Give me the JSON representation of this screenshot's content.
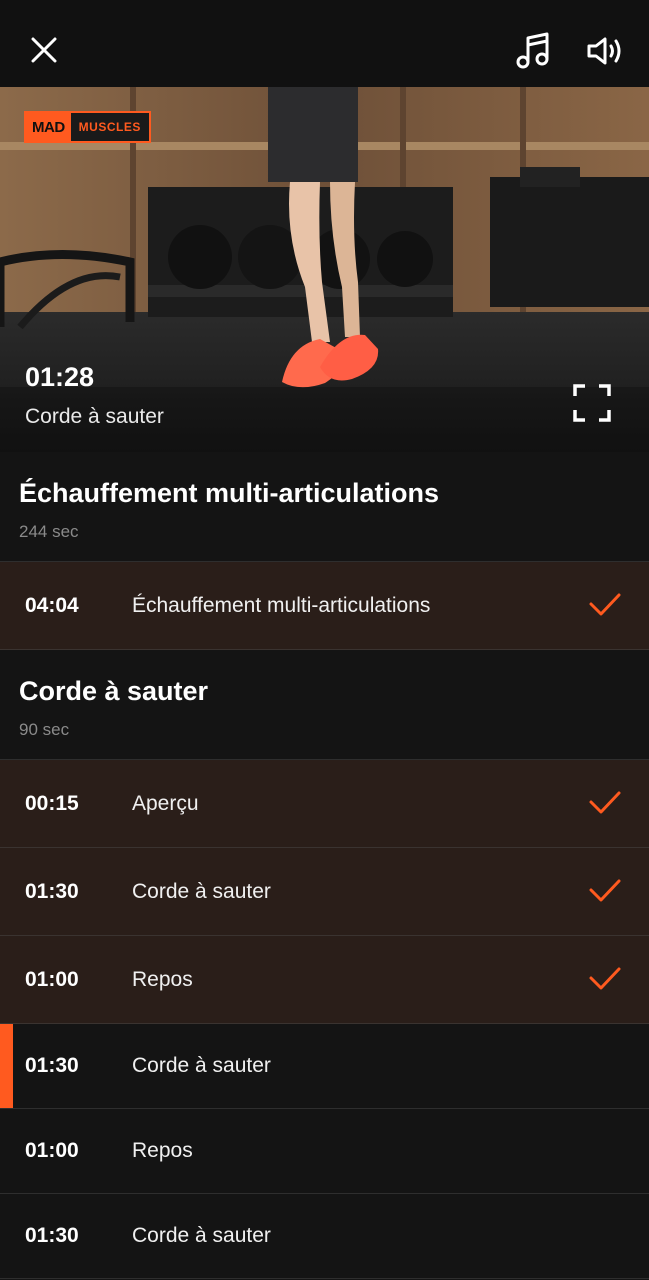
{
  "topbar": {
    "close_icon": "close-icon",
    "music_icon": "music-note-icon",
    "sound_icon": "speaker-icon"
  },
  "video": {
    "logo_left": "MAD",
    "logo_right": "MUSCLES",
    "time": "01:28",
    "exercise_name": "Corde à sauter",
    "fullscreen_icon": "fullscreen-icon"
  },
  "colors": {
    "accent": "#ff5a1f",
    "done_bg": "#2a1e19",
    "bg": "#141414"
  },
  "sections": [
    {
      "title": "Échauffement multi-articulations",
      "duration": "244 sec",
      "items": [
        {
          "time": "04:04",
          "name": "Échauffement multi-articulations",
          "done": true
        }
      ]
    },
    {
      "title": "Corde à sauter",
      "duration": "90 sec",
      "items": [
        {
          "time": "00:15",
          "name": "Aperçu",
          "done": true
        },
        {
          "time": "01:30",
          "name": "Corde à sauter",
          "done": true
        },
        {
          "time": "01:00",
          "name": "Repos",
          "done": true
        },
        {
          "time": "01:30",
          "name": "Corde à sauter",
          "done": false,
          "current": true
        },
        {
          "time": "01:00",
          "name": "Repos",
          "done": false
        },
        {
          "time": "01:30",
          "name": "Corde à sauter",
          "done": false
        }
      ]
    }
  ]
}
